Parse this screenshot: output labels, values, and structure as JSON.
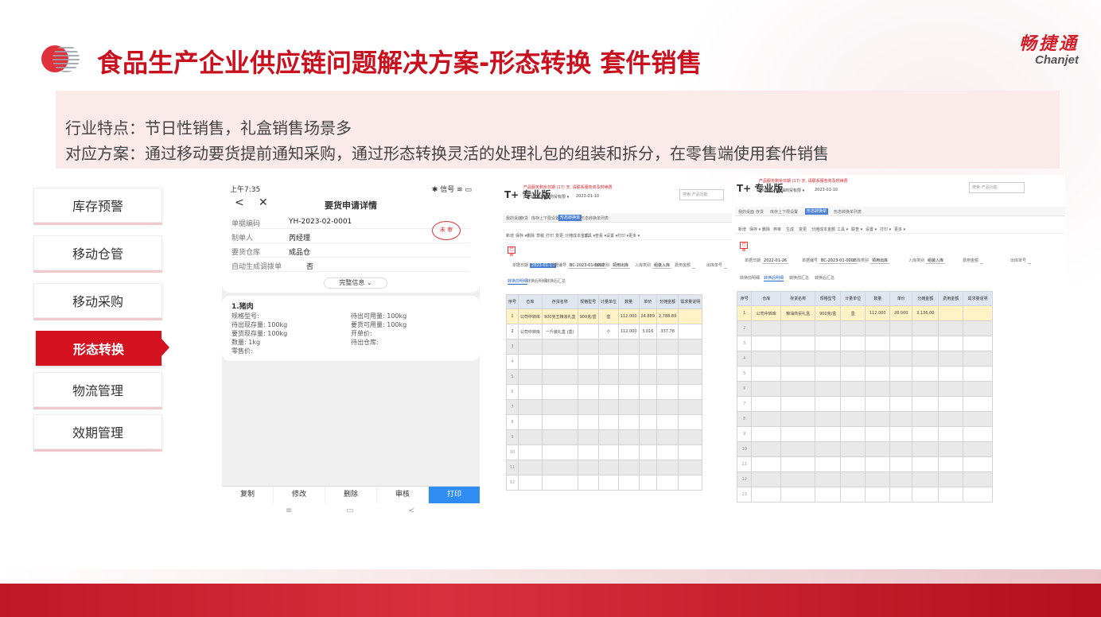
{
  "title": "食品生产企业供应链问题解决方案-形态转换 套件销售",
  "brand": {
    "name_cn": "畅捷通",
    "name_en": "Chanjet"
  },
  "info": {
    "line1": "行业特点：节日性销售，礼盒销售场景多",
    "line2": "对应方案：通过移动要货提前通知采购，通过形态转换灵活的处理礼包的组装和拆分，在零售端使用套件销售"
  },
  "colors": {
    "accent": "#d4111f",
    "title": "#c8101e",
    "info_bg": "#fbeaea",
    "phone_primary": "#2f8cf0"
  },
  "nav": {
    "items": [
      {
        "label": "库存预警",
        "active": false
      },
      {
        "label": "移动仓管",
        "active": false
      },
      {
        "label": "移动采购",
        "active": false
      },
      {
        "label": "形态转换",
        "active": true
      },
      {
        "label": "物流管理",
        "active": false
      },
      {
        "label": "效期管理",
        "active": false
      }
    ]
  },
  "phone": {
    "status_time": "上午7:35",
    "status_icons": "✱ 信号 ≋ ▭",
    "back_icon": "<",
    "close_icon": "✕",
    "header_title": "要货申请详情",
    "fields": [
      {
        "label": "单据编码",
        "value": "YH-2023-02-0001"
      },
      {
        "label": "制单人",
        "value": "芮经理"
      },
      {
        "label": "要货仓库",
        "value": "成品仓"
      },
      {
        "label": "自动生成调拨单",
        "value": "否"
      }
    ],
    "stamp": "未 审",
    "more_label": "完整信息 ⌄",
    "item_title": "1.猪肉",
    "item_fields": [
      "规格型号:",
      "待出可用量: 100kg",
      "待出现存量: 100kg",
      "要货可用量: 100kg",
      "要货现存量: 100kg",
      "开单价:",
      "数量: 1kg",
      "待出仓库:",
      "零售价:",
      ""
    ],
    "actions": [
      "复制",
      "修改",
      "删除",
      "审核",
      "打印"
    ],
    "nav_icons": [
      "≡",
      "▭",
      "<"
    ]
  },
  "erp_left": {
    "logo": "T+ 专业版",
    "alert": "产品服务剩余日期 (17) 天, 请联系服务商及时续费",
    "account": "[000004]粮油商贸有限 ▾",
    "date": "2023-01-10",
    "search_placeholder": "搜索-产品功能",
    "tabs": [
      "我的桌面",
      "存货",
      "库存上下限设置",
      "形态转换单",
      "形态转换单列表"
    ],
    "active_tab": 3,
    "toolbar": [
      "新增",
      "保存 ▾",
      "删除",
      "草稿",
      "打印",
      "变更",
      "分摊成本金额",
      "工具 ▾",
      "查看 ▾",
      "设置 ▾",
      "打印 ▾",
      "更多 ▾"
    ],
    "badge": "已审",
    "fields": [
      {
        "label": "单据日期",
        "value": "2023-01-10"
      },
      {
        "label": "单据编号",
        "value": "BC-2023-01-0002"
      },
      {
        "label": "出库类别",
        "value": "领用出库"
      },
      {
        "label": "入库类别",
        "value": "组装入库"
      },
      {
        "label": "费用金额",
        "value": ""
      },
      {
        "label": "出库单号",
        "value": ""
      }
    ],
    "subtabs": [
      "转换前明细",
      "转换后明细",
      "转换后汇总"
    ],
    "active_subtab": 0,
    "columns": [
      "序号",
      "仓库",
      "存货名称",
      "规格型号",
      "计量单位",
      "数量",
      "单价",
      "分摊金额",
      "需求量说明"
    ],
    "rows": [
      [
        "1",
        "公司中转库",
        "900克五粮液礼盒",
        "900克/盒",
        "盒",
        "112.000",
        "24.889",
        "2,788.89",
        ""
      ],
      [
        "2",
        "公司中转库",
        "一斤装礼盒 (盒)",
        "",
        "个",
        "112.000",
        "3.016",
        "337.78",
        ""
      ]
    ],
    "empty_rows": [
      "3",
      "4",
      "5",
      "6",
      "7",
      "8",
      "9",
      "10",
      "11",
      "12"
    ]
  },
  "erp_right": {
    "logo": "T+ 专业版",
    "alert": "产品服务剩余日期 (17) 天, 请联系服务商及时续费",
    "account": "[000004]粮油商贸有限 ▾",
    "date": "2023-01-10",
    "search_placeholder": "搜索-产品功能",
    "tabs": [
      "我的桌面",
      "存货",
      "库存上下限设置",
      "形态转换单",
      "形态转换单列表"
    ],
    "active_tab": 3,
    "toolbar": [
      "新增",
      "保存 ▾",
      "删除",
      "弃审",
      "生成",
      "变更",
      "分摊成本金额",
      "工具 ▾",
      "联查 ▾",
      "设置 ▾",
      "打印 ▾",
      "更多 ▾"
    ],
    "badge": "已审",
    "fields": [
      {
        "label": "单据日期",
        "value": "2022-01-26"
      },
      {
        "label": "单据编号",
        "value": "BC-2023-01-0002"
      },
      {
        "label": "出库类别",
        "value": "领用出库"
      },
      {
        "label": "入库类别",
        "value": "组装入库"
      },
      {
        "label": "费用金额",
        "value": ""
      },
      {
        "label": "出库单号",
        "value": ""
      }
    ],
    "subtabs": [
      "转换前明细",
      "转换后明细",
      "转换前汇总",
      "转换后汇总"
    ],
    "active_subtab": 1,
    "columns": [
      "序号",
      "仓库",
      "存货名称",
      "规格型号",
      "计量单位",
      "数量",
      "单价",
      "分摊金额",
      "费用金额",
      "需求量说明"
    ],
    "rows": [
      [
        "1",
        "公司中转库",
        "粮油商贸礼盒",
        "900克/盒",
        "盒",
        "112.000",
        "28.000",
        "3,136.00",
        "",
        ""
      ]
    ],
    "empty_rows": [
      "2",
      "3",
      "4",
      "5",
      "6",
      "7",
      "8",
      "9",
      "10",
      "11",
      "12",
      "13"
    ]
  }
}
